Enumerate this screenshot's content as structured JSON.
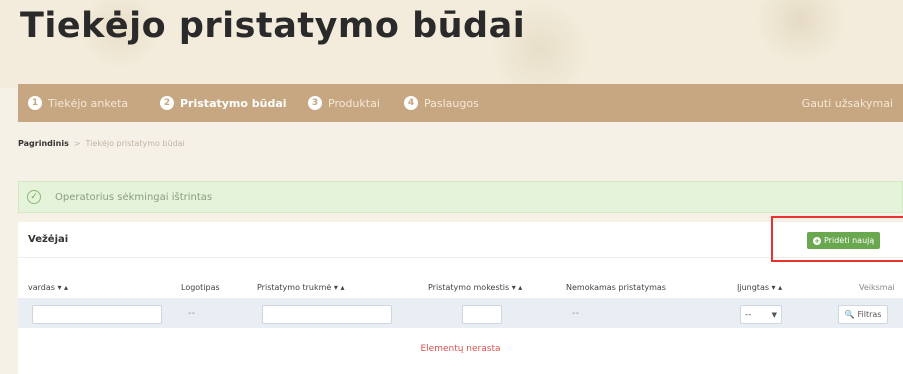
{
  "page": {
    "title": "Tiekėjo pristatymo būdai"
  },
  "steps": [
    {
      "num": "1",
      "label": "Tiekėjo anketa"
    },
    {
      "num": "2",
      "label": "Pristatymo būdai"
    },
    {
      "num": "3",
      "label": "Produktai"
    },
    {
      "num": "4",
      "label": "Paslaugos"
    }
  ],
  "orders_link": "Gauti užsakymai",
  "breadcrumb": {
    "home": "Pagrindinis",
    "separator": ">",
    "current": "Tiekėjo pristatymo būdai"
  },
  "alert": {
    "icon": "check-circle-icon",
    "text": "Operatorius sėkmingai ištrintas"
  },
  "panel": {
    "title": "Vežėjai",
    "add_button": "Pridėti naują"
  },
  "table": {
    "columns": {
      "name": "vardas ▾ ▴",
      "logo": "Logotipas",
      "duration": "Pristatymo trukmė ▾ ▴",
      "fee": "Pristatymo mokestis ▾ ▴",
      "free": "Nemokamas pristatymas",
      "enabled": "Įjungtas ▾ ▴",
      "actions": "Veiksmai"
    },
    "filters": {
      "logo_placeholder": "--",
      "free_placeholder": "--",
      "enabled_value": "--",
      "filter_button": "Filtras"
    },
    "empty_text": "Elementų nerasta"
  },
  "colors": {
    "stepbar": "#c7a781",
    "add_button": "#6aa84f",
    "highlight_box": "#e8322d",
    "alert_bg": "#e4f3da",
    "empty_text": "#d9534f"
  }
}
